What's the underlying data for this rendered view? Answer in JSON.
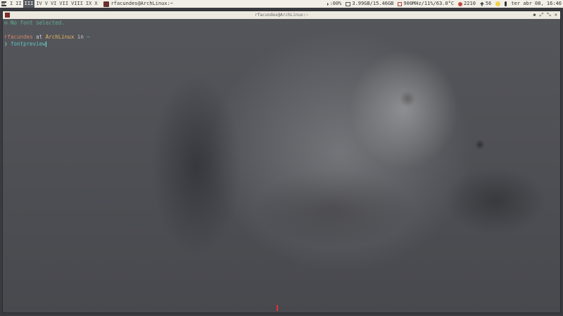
{
  "topbar": {
    "workspaces": [
      "I",
      "II",
      "III",
      "IV",
      "V",
      "VI",
      "VII",
      "VIII",
      "IX",
      "X"
    ],
    "active_workspace": "III",
    "task_title": "rfacundes@ArchLinux:~",
    "volume": ":00%",
    "memory": "3.99GB/15.46GB",
    "cpu": "900MHz/11%/63.0°C",
    "temp": "2210",
    "updates": "56",
    "datetime": "ter abr 08, 16:46"
  },
  "window": {
    "title": "rfacundes@ArchLinux:~",
    "buttons": [
      "◆",
      "⤢",
      "⤡",
      "✕"
    ]
  },
  "terminal": {
    "status_symbol": "⊘",
    "status_text": "No font selected.",
    "prompt_user": "rfacundes",
    "prompt_at": "at",
    "prompt_host": "ArchLinux",
    "prompt_in": "in",
    "prompt_dir": "~",
    "prompt_symbol": "❯",
    "command": "fontpreview"
  },
  "colors": {
    "topbar_bg": "#f1efe6",
    "terminal_bg": "#5a5a5f",
    "prompt_green": "#5fae8e",
    "prompt_orange": "#d08770",
    "command_cyan": "#5ec4c4"
  }
}
